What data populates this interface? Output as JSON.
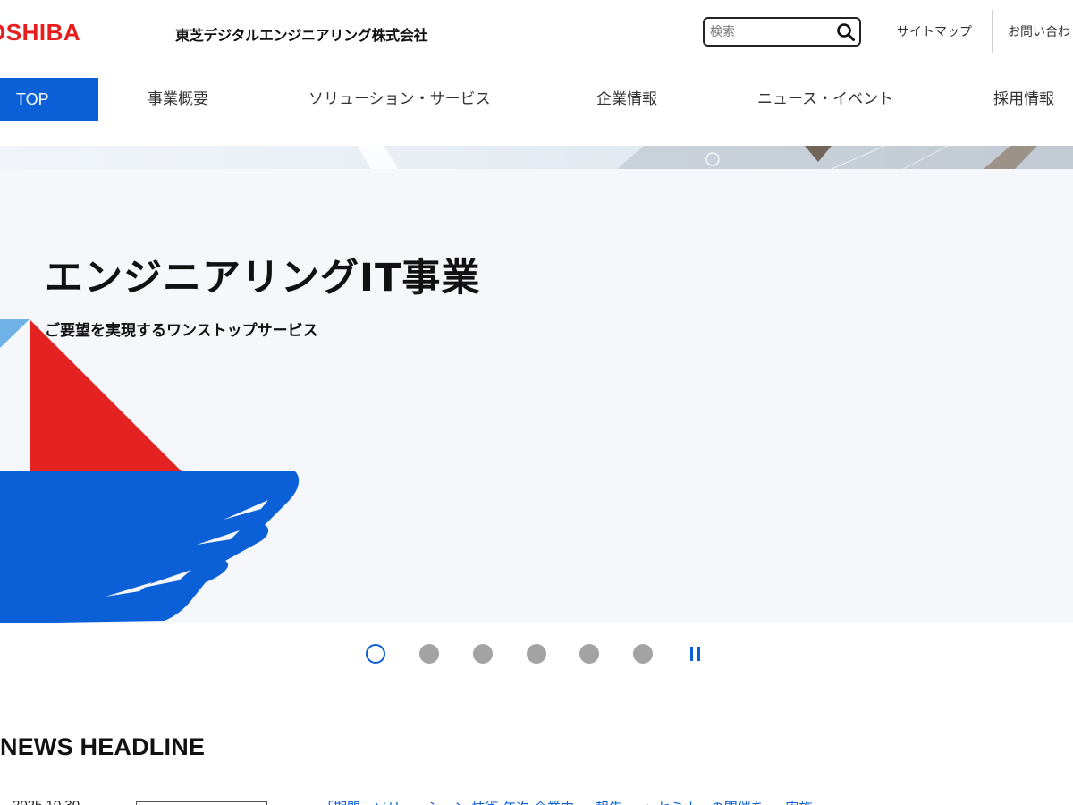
{
  "header": {
    "logo_text": "OSHIBA",
    "company_name": "東芝デジタルエンジニアリング株式会社",
    "search": {
      "placeholder": "検索",
      "icon": "search-icon"
    },
    "links": {
      "sitemap": "サイトマップ",
      "contact": "お問い合わ"
    }
  },
  "nav": {
    "items": [
      "TOP",
      "事業概要",
      "ソリューション・サービス",
      "企業情報",
      "ニュース・イベント",
      "採用情報"
    ],
    "active_index": 0
  },
  "hero": {
    "title": "エンジニアリングIT事業",
    "subtitle": "ご要望を実現するワンストップサービス",
    "colors": {
      "red": "#e42222",
      "blue": "#0b5fd7",
      "light_blue": "#6fb2e6"
    }
  },
  "carousel": {
    "slide_count": 6,
    "active_index": 0,
    "pause_icon": "pause-icon"
  },
  "news": {
    "heading": "NEWS HEADLINE",
    "items": [
      {
        "date": "2025.10.30",
        "category": "",
        "text": "「期間・ソリューション 技術 年次 企業内 ... 報告 ... 」セミナーの開催を ... 実施 ... "
      }
    ]
  },
  "colors": {
    "brand_red": "#e61e1e",
    "accent_blue": "#0b5fd7",
    "dot_gray": "#a3a3a3"
  }
}
